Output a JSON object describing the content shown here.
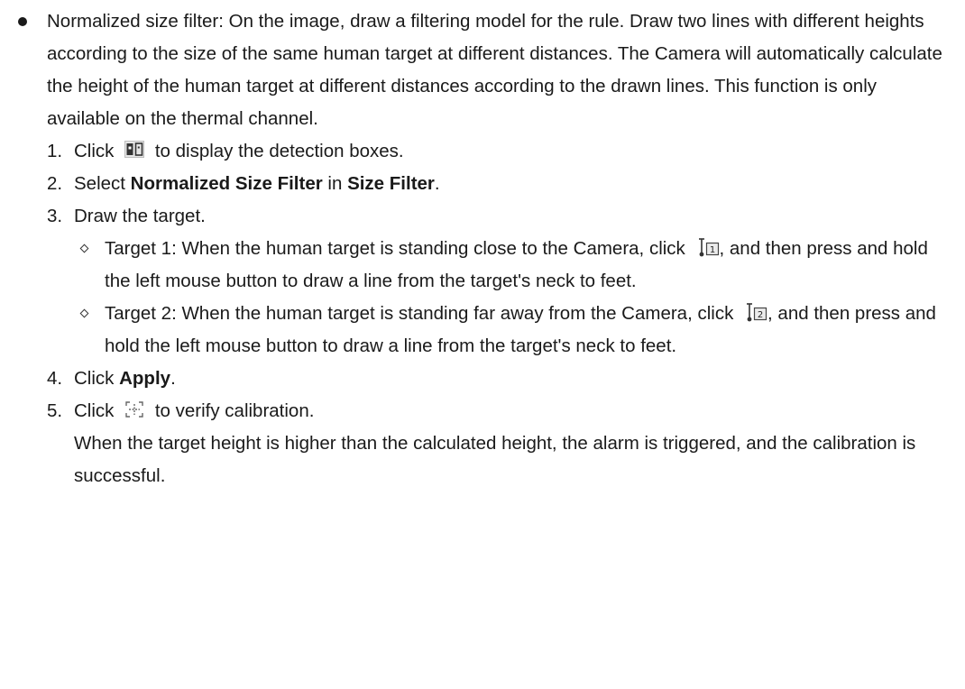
{
  "intro": {
    "text": "Normalized size filter: On the image, draw a filtering model for the rule. Draw two lines with different heights according to the size of the same human target at different distances. The Camera will automatically calculate the height of the human target at different distances according to the drawn lines. This function is only available on the thermal channel."
  },
  "steps": [
    {
      "num": "1.",
      "pre": "Click",
      "post": "to display the detection boxes.",
      "icon": "detection-box-icon"
    },
    {
      "num": "2.",
      "a": "Select ",
      "b1": "Normalized Size Filter",
      "c": " in ",
      "b2": "Size Filter",
      "d": "."
    },
    {
      "num": "3.",
      "text": "Draw the target."
    },
    {
      "num": "4.",
      "a": "Click ",
      "b1": "Apply",
      "d": "."
    },
    {
      "num": "5.",
      "pre": "Click",
      "post": "to verify calibration.",
      "icon": "calibration-verify-icon",
      "note": "When the target height is higher than the calculated height, the alarm is triggered, and the calibration is successful."
    }
  ],
  "targets": [
    {
      "pre": "Target 1: When the human target is standing close to the Camera, click",
      "post": ", and then press and hold the left mouse button to draw a line from the target's neck to feet.",
      "icon": "target-1-line-icon",
      "icon_label": "1"
    },
    {
      "pre": "Target 2: When the human target is standing far away from the Camera, click",
      "post": ", and then press and hold the left mouse button to draw a line from the target's neck to feet.",
      "icon": "target-2-line-icon",
      "icon_label": "2"
    }
  ]
}
